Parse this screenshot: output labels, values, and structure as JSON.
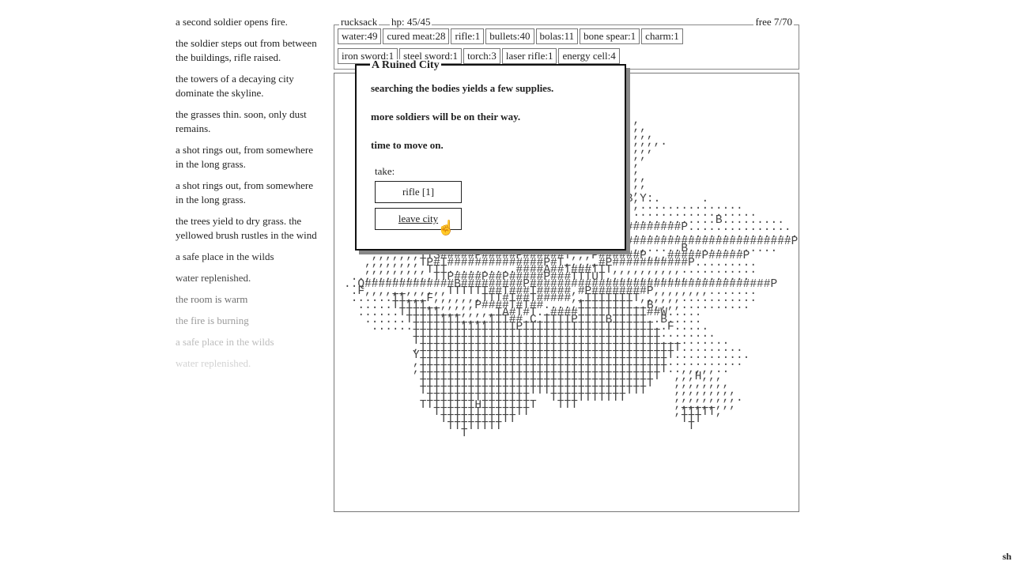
{
  "log": [
    {
      "text": "a second soldier opens fire.",
      "opacity": 1
    },
    {
      "text": "the soldier steps out from between the buildings, rifle raised.",
      "opacity": 1
    },
    {
      "text": "the towers of a decaying city dominate the skyline.",
      "opacity": 1
    },
    {
      "text": "the grasses thin. soon, only dust remains.",
      "opacity": 1
    },
    {
      "text": "a shot rings out, from somewhere in the long grass.",
      "opacity": 1
    },
    {
      "text": "a shot rings out, from somewhere in the long grass.",
      "opacity": 1
    },
    {
      "text": "the trees yield to dry grass. the yellowed brush rustles in the wind",
      "opacity": 1
    },
    {
      "text": "a safe place in the wilds",
      "opacity": 0.95
    },
    {
      "text": "water replenished.",
      "opacity": 0.85
    },
    {
      "text": "the room is warm",
      "opacity": 0.65
    },
    {
      "text": "the fire is burning",
      "opacity": 0.45
    },
    {
      "text": "a safe place in the wilds",
      "opacity": 0.3
    },
    {
      "text": "water replenished.",
      "opacity": 0.2
    }
  ],
  "rucksack": {
    "label": "rucksack",
    "hp": "hp: 45/45",
    "free": "free 7/70",
    "items": [
      "water:49",
      "cured meat:28",
      "rifle:1",
      "bullets:40",
      "bolas:11",
      "bone spear:1",
      "charm:1",
      "iron sword:1",
      "steel sword:1",
      "torch:3",
      "laser rifle:1",
      "energy cell:4"
    ]
  },
  "dialog": {
    "title": "A Ruined City",
    "lines": [
      "searching the bodies yields a few supplies.",
      "more soldiers will be on their way.",
      "time to move on."
    ],
    "take_label": "take:",
    "buttons": [
      "rifle [1]",
      "leave city"
    ]
  },
  "map_rows": [
    "                                          ,",
    "                                          ,,",
    "                                          ,,,",
    "                                          ,,,,.",
    "                                          ,,,",
    "                                          ,,",
    "                                          ,",
    "                                          ,",
    "                                          ,,",
    "                                          ,,",
    "                                         ,,",
    "                                         B,Y:.      .",
    "                                         ,,...............",
    "                                         ,..................",
    "                                         ,............B.........",
    "                                         ########P...............",
    "                                         ,........................",
    "                                         ########################P",
    "     ,,,,F..........P#####P####T.T,,,,,,,,,,.....B.............",
    "    ,,,,,,,TTS#####P#####P######T,,,P######P,,,#####P#####P",
    "   ,,,,,,,,TP#T##############P#T,,,,,#P###########P.........",
    "   ,,,,,,,,,TTT..........####A##T###TTT,,,,,,,,,,...........",
    " ..,,,,,,,,,,TTP####P##P#####P###TTTUT,,,,,,,,,,,,.........",
    "..Q#############B#########P###################################P",
    " .F,,,,,,,,,,,,TTTTTT##T###T#####,#P########P,,,,,,,,.......",
    " ......TT,,,F,,,,,,,TTT#T##T#####,,TTTTTTTT,,,,,,...........",
    "  .....TTTTT,,,,,,,P####T#T##....,TTTTTTTT..B,,,,..........",
    "  ......TTTTTT,,,,,,,,TA#T#T..####TTTTTTTTTT##W.....",
    "   ......TTTTTTTT,,,,TTT##.C.TTTTPTTTTBTTTTT..B.....",
    "    ......TTTTTTTTTTTTTTTPTTTTTTTTTTTTTTTTTTT..F.....",
    "          TTTTTTTTTTTTTTTTTTTTTTTTTTTTTTTTTTTT........",
    "          TTTTTTTTTTTTTTTTTTTTTTTTTTTTTTTTTTTT..........",
    "          ,TTTTTTTTTTTTTTTTTTTTTTTTTTTTTTTTTTTTTT.........",
    "          YTTTTTTTTTTTTTTTTTTTTTTTTTTTTTTTTTTTTT...........",
    "          ,TTTTTTTTTTTTTTTTTTTTTTTTTTTTTTTTTTTT...........",
    "          ,TTTTTTTTTTTTTTTTTTTTTTTTTTTTTTTTTTTT..,,,,,..",
    "           TTTTTTTTTTTTTTTTTTTTTTTTTTTTTTTTTTT  ,,,H,,,",
    "           TTTTTTTTTTTTTTTTTTTTTTTTTTTTTTTTTT   ,,,,,,,,",
    "           TTTTTTTTTTTTTTTTTTTTTTTTTTTTTTTTT    ,,,,,,,,,",
    "            TTTTTTTTTTTTTTT   TTTTTTTTTTT       ,,,,,,,,,.",
    "           TTTTTTTTHTTTTTTTT   TTT              ,,,,,,,,,",
    "             TTTTTTTTTTTTTT                     ,TTTTT,",
    "              TTTTTTTTTTT                        TTT",
    "               TTTTTTTT                           T",
    "                 T"
  ],
  "corner_text": "sh"
}
